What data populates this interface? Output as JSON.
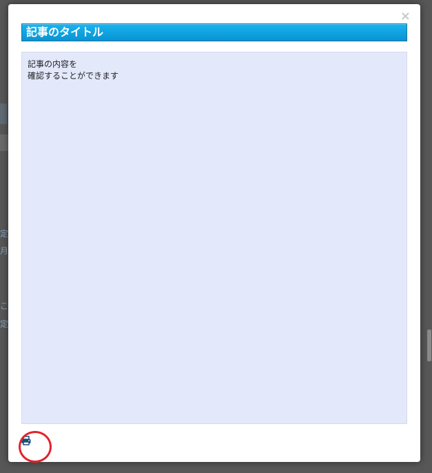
{
  "modal": {
    "close_label": "×",
    "title": "記事のタイトル",
    "content_lines": [
      "記事の内容を",
      "確認することができます"
    ],
    "print_icon": "printer-icon"
  },
  "background": {
    "fragments": [
      "定",
      "月",
      "こ",
      "定"
    ]
  },
  "colors": {
    "title_bar": "#0fa4e0",
    "content_bg": "#e3e8fb",
    "highlight": "#e2232a",
    "overlay": "#575757"
  }
}
